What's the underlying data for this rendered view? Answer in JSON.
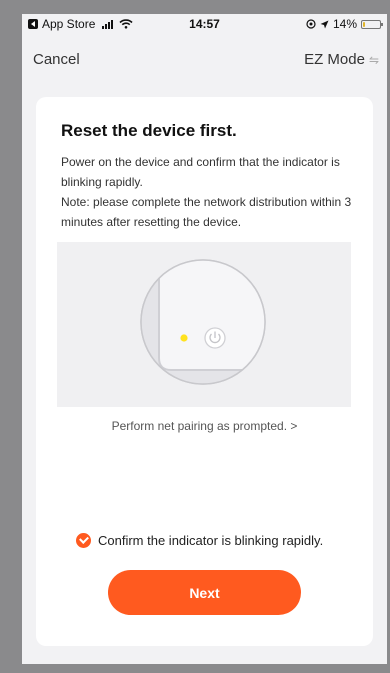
{
  "status_bar": {
    "back_app": "App Store",
    "time": "14:57",
    "battery": "14%",
    "battery_level": 0.14,
    "icons": [
      "back-arrow-icon",
      "signal-icon",
      "wifi-icon",
      "location-lock-icon",
      "location-arrow-icon",
      "battery-icon"
    ]
  },
  "nav": {
    "cancel_label": "Cancel",
    "mode_label": "EZ Mode",
    "mode_icon": "swap-arrows-icon"
  },
  "card": {
    "title": "Reset the device first.",
    "description_1": "Power on the device and confirm that the indicator is blinking rapidly.",
    "description_2": "Note: please complete the network distribution within 3 minutes after resetting the device.",
    "illustration_icons": [
      "indicator-light-icon",
      "power-icon"
    ],
    "pairing_link": "Perform net pairing as prompted. >",
    "confirm_label": "Confirm the indicator is blinking rapidly.",
    "confirm_checked": true,
    "next_label": "Next"
  },
  "colors": {
    "accent": "#ff5a1f",
    "indicator": "#ffe21f",
    "background": "#f2f2f4"
  }
}
